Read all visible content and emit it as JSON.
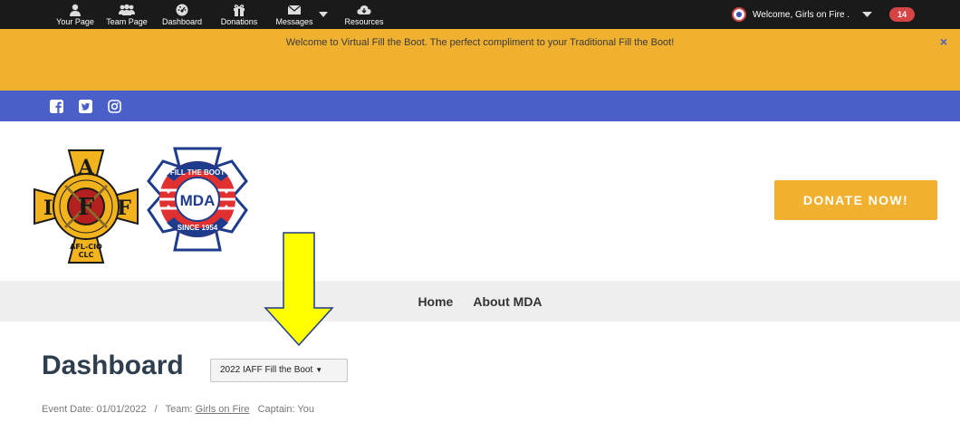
{
  "topnav": {
    "items": [
      {
        "label": "Your Page",
        "icon": "user-icon"
      },
      {
        "label": "Team Page",
        "icon": "team-icon"
      },
      {
        "label": "Dashboard",
        "icon": "dashboard-icon"
      },
      {
        "label": "Donations",
        "icon": "gift-icon"
      },
      {
        "label": "Messages",
        "icon": "envelope-icon"
      },
      {
        "label": "Resources",
        "icon": "cloud-icon"
      }
    ],
    "welcome": "Welcome, Girls on Fire .",
    "notification_count": "14"
  },
  "banner": {
    "text": "Welcome to Virtual Fill the Boot.  The perfect compliment to your Traditional Fill the Boot!",
    "close": "×"
  },
  "social": [
    "facebook-icon",
    "twitter-icon",
    "instagram-icon"
  ],
  "logos": {
    "mda": {
      "text": "MDA",
      "top_arc": "FILL THE BOOT",
      "bottom_arc": "SINCE 1954"
    }
  },
  "donate_label": "DONATE NOW!",
  "nav": {
    "items": [
      "Home",
      "About MDA"
    ]
  },
  "dashboard": {
    "title": "Dashboard",
    "event_selected": "2022 IAFF Fill the Boot",
    "event_date_label": "Event Date: 01/01/2022",
    "separator": "/",
    "team_label": "Team:",
    "team_name": "Girls on Fire",
    "captain_label": "Captain: You"
  },
  "colors": {
    "topbar": "#1a1a1a",
    "banner": "#f0b030",
    "social_bar": "#4a5fc8",
    "donate": "#f0b030",
    "badge": "#d64545",
    "arrow": "#ffff00"
  }
}
